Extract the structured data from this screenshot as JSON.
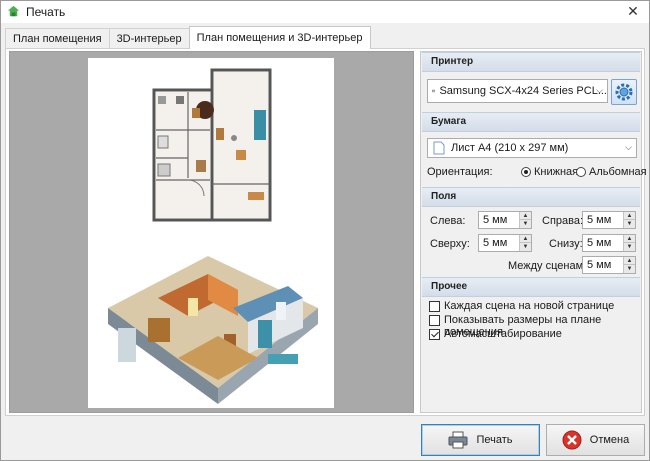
{
  "window": {
    "title": "Печать"
  },
  "tabs": [
    {
      "label": "План помещения",
      "active": false
    },
    {
      "label": "3D-интерьер",
      "active": false
    },
    {
      "label": "План помещения и 3D-интерьер",
      "active": true
    }
  ],
  "printer": {
    "header": "Принтер",
    "selected": "Samsung SCX-4x24 Series PCL...",
    "settings_icon": "gear-icon"
  },
  "paper": {
    "header": "Бумага",
    "selected": "Лист А4 (210 x 297 мм)",
    "orientation_label": "Ориентация:",
    "orientation_options": [
      {
        "label": "Книжная",
        "checked": true
      },
      {
        "label": "Альбомная",
        "checked": false
      }
    ]
  },
  "margins": {
    "header": "Поля",
    "left_label": "Слева:",
    "left_value": "5 мм",
    "right_label": "Справа:",
    "right_value": "5 мм",
    "top_label": "Сверху:",
    "top_value": "5 мм",
    "bottom_label": "Снизу:",
    "bottom_value": "5 мм",
    "between_label": "Между сценами:",
    "between_value": "5 мм"
  },
  "other": {
    "header": "Прочее",
    "options": [
      {
        "label": "Каждая сцена на новой странице",
        "checked": false
      },
      {
        "label": "Показывать размеры на плане помещения",
        "checked": false
      },
      {
        "label": "Автомасштабирование",
        "checked": true
      }
    ]
  },
  "buttons": {
    "print_label": "Печать",
    "cancel_label": "Отмена"
  },
  "colors": {
    "accent": "#3c7fb1",
    "section_header": "#dbe3ee",
    "preview_bg": "#a9a9a9",
    "cancel_icon": "#d9342b"
  }
}
